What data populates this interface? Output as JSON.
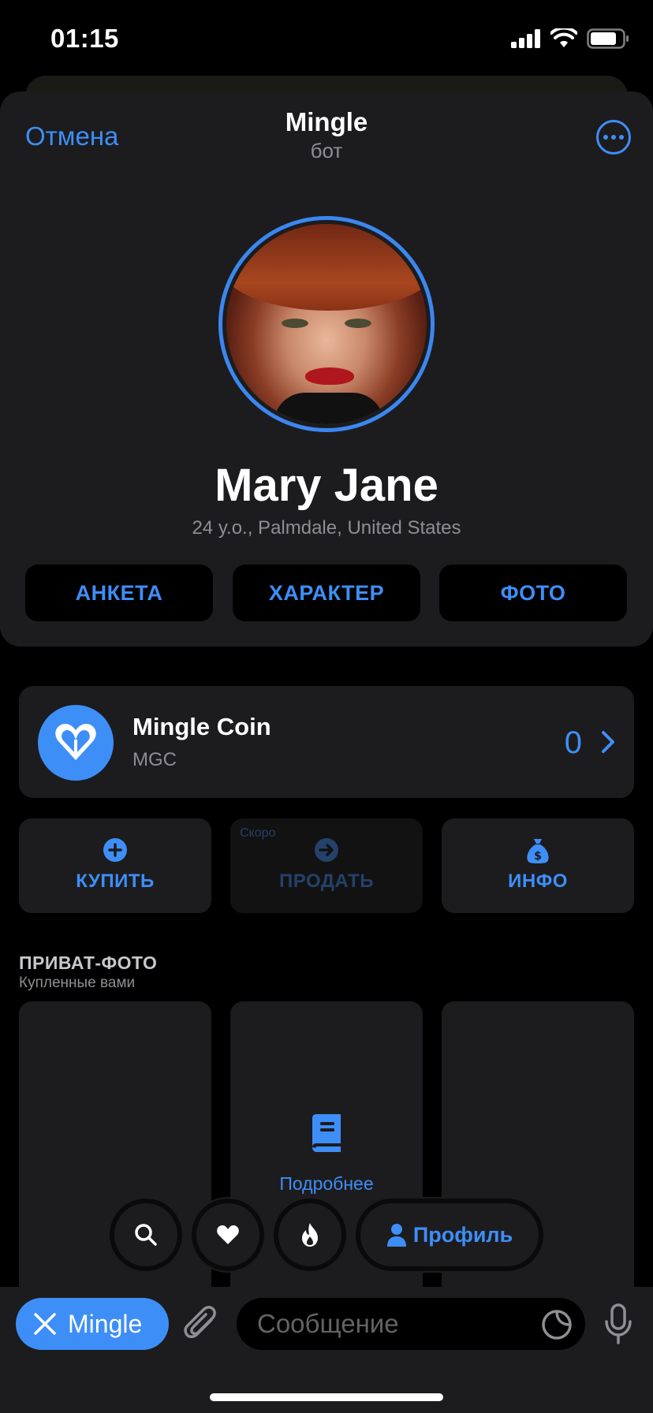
{
  "status": {
    "time": "01:15"
  },
  "header": {
    "cancel": "Отмена",
    "title": "Mingle",
    "subtitle": "бот"
  },
  "profile": {
    "name": "Mary Jane",
    "meta": "24 y.o., Palmdale, United States"
  },
  "tabs": [
    {
      "label": "АНКЕТА"
    },
    {
      "label": "ХАРАКТЕР"
    },
    {
      "label": "ФОТО"
    }
  ],
  "coin": {
    "name": "Mingle Coin",
    "symbol": "MGC",
    "balance": "0"
  },
  "actions": [
    {
      "label": "КУПИТЬ",
      "icon": "plus-circle-icon"
    },
    {
      "label": "ПРОДАТЬ",
      "icon": "arrow-right-circle-icon",
      "badge": "Скоро"
    },
    {
      "label": "ИНФО",
      "icon": "money-bag-icon"
    }
  ],
  "private_photos": {
    "title": "ПРИВАТ-ФОТО",
    "subtitle": "Купленные вами",
    "more": "Подробнее"
  },
  "bottom_nav": {
    "profile_label": "Профиль"
  },
  "composer": {
    "bot_label": "Mingle",
    "placeholder": "Сообщение"
  },
  "colors": {
    "accent": "#3e8ef7",
    "card": "#1c1c1e",
    "background": "#000000"
  }
}
